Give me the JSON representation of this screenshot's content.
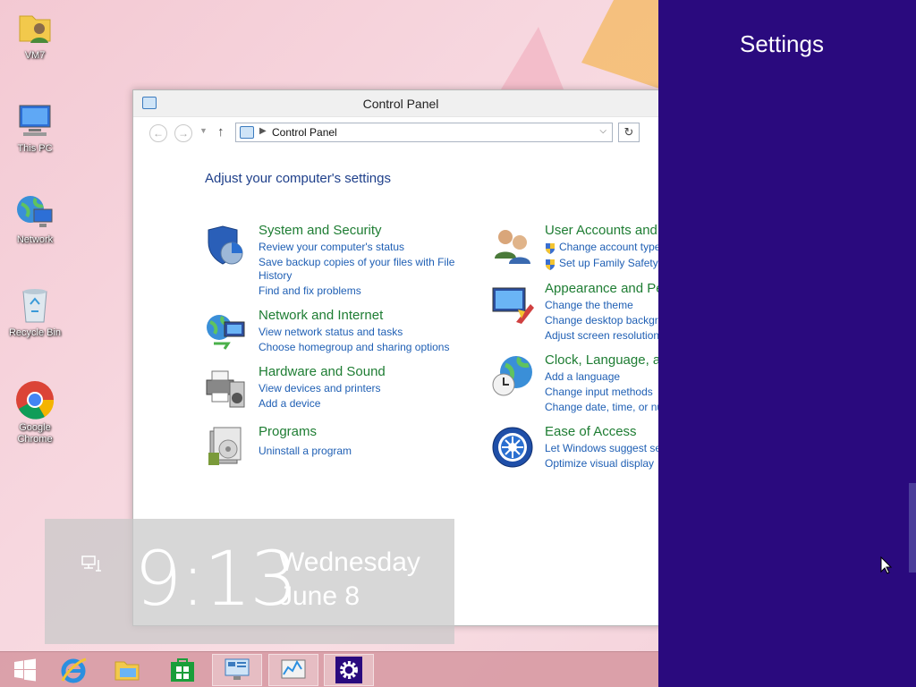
{
  "desktop": {
    "icons": [
      {
        "label": "VM7"
      },
      {
        "label": "This PC"
      },
      {
        "label": "Network"
      },
      {
        "label": "Recycle Bin"
      },
      {
        "label": "Google Chrome"
      }
    ]
  },
  "window": {
    "title": "Control Panel",
    "address": "Control Panel",
    "heading": "Adjust your computer's settings",
    "categories": [
      {
        "title": "System and Security",
        "links": [
          "Review your computer's status",
          "Save backup copies of your files with File",
          "History",
          "Find and fix problems"
        ]
      },
      {
        "title": "Network and Internet",
        "links": [
          "View network status and tasks",
          "Choose homegroup and sharing options"
        ]
      },
      {
        "title": "Hardware and Sound",
        "links": [
          "View devices and printers",
          "Add a device"
        ]
      },
      {
        "title": "Programs",
        "links": [
          "Uninstall a program"
        ]
      },
      {
        "title": "User Accounts and",
        "links": [
          "Change account type",
          "Set up Family Safety f"
        ]
      },
      {
        "title": "Appearance and Pe",
        "links": [
          "Change the theme",
          "Change desktop backgro",
          "Adjust screen resolution"
        ]
      },
      {
        "title": "Clock, Language, a",
        "links": [
          "Add a language",
          "Change input methods",
          "Change date, time, or nu"
        ]
      },
      {
        "title": "Ease of Access",
        "links": [
          "Let Windows suggest se",
          "Optimize visual display"
        ]
      }
    ]
  },
  "clock": {
    "time": "9:13",
    "day": "Wednesday",
    "date": "June 8"
  },
  "charm": {
    "title": "Settings",
    "bg_color": "#2a0a7e"
  },
  "taskbar": {
    "items": [
      "start-icon",
      "internet-explorer-icon",
      "file-explorer-icon",
      "store-icon",
      "control-panel-icon",
      "performance-icon",
      "settings-icon"
    ]
  }
}
